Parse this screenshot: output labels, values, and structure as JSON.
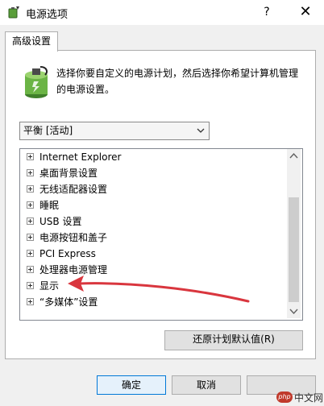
{
  "window": {
    "title": "电源选项",
    "help_label": "?",
    "close_label": "✕"
  },
  "tab": {
    "label": "高级设置"
  },
  "description": "选择你要自定义的电源计划，然后选择你希望计算机管理的电源设置。",
  "plan_dropdown": {
    "value": "平衡 [活动]"
  },
  "settings_tree": {
    "items": [
      {
        "label": "Internet Explorer"
      },
      {
        "label": "桌面背景设置"
      },
      {
        "label": "无线适配器设置"
      },
      {
        "label": "睡眠"
      },
      {
        "label": "USB 设置"
      },
      {
        "label": "电源按钮和盖子"
      },
      {
        "label": "PCI Express"
      },
      {
        "label": "处理器电源管理"
      },
      {
        "label": "显示"
      },
      {
        "label": "“多媒体”设置"
      }
    ]
  },
  "buttons": {
    "restore_defaults": "还原计划默认值(R)",
    "ok": "确定",
    "cancel": "取消"
  },
  "watermark": {
    "badge": "php",
    "text": "中文网"
  },
  "colors": {
    "annotation_arrow": "#d9363e",
    "focus_border": "#0078d7"
  }
}
